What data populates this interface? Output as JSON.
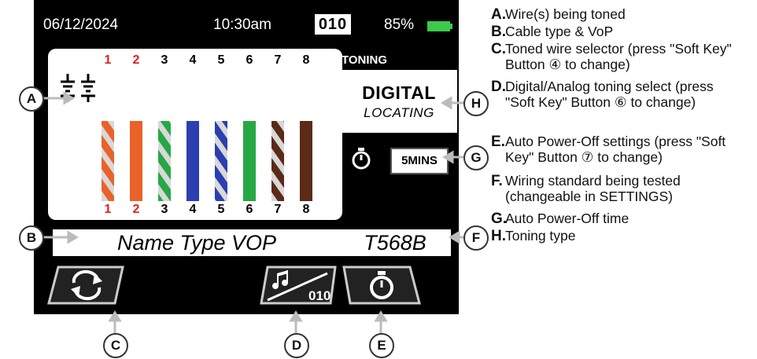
{
  "device": {
    "status_bar": {
      "date": "06/12/2024",
      "time": "10:30am",
      "mode": "010",
      "battery": "85%"
    },
    "wire_panel": {
      "top_pins": [
        "1",
        "2",
        "3",
        "4",
        "5",
        "6",
        "7",
        "8"
      ],
      "bottom_pins": [
        "1",
        "2",
        "3",
        "4",
        "5",
        "6",
        "7",
        "8"
      ],
      "toned_pins": [
        "1",
        "2"
      ],
      "wire_colors": [
        {
          "stripe": "#e9622a",
          "solid": false
        },
        {
          "stripe": "#e9622a",
          "solid": true
        },
        {
          "stripe": "#27a844",
          "solid": false
        },
        {
          "stripe": "#2c3fb0",
          "solid": true
        },
        {
          "stripe": "#2c3fb0",
          "solid": false
        },
        {
          "stripe": "#27a844",
          "solid": true
        },
        {
          "stripe": "#5a2b17",
          "solid": false
        },
        {
          "stripe": "#5a2b17",
          "solid": true
        }
      ]
    },
    "toning": {
      "header": "TONING",
      "type_line1": "DIGITAL",
      "type_line2": "LOCATING"
    },
    "timer_value": "5MINS",
    "cable_info": "Name Type VOP",
    "wiring_standard": "T568B",
    "softkey_center_label": "010"
  },
  "callouts": {
    "a": "A",
    "b": "B",
    "c": "C",
    "d": "D",
    "e": "E",
    "f": "F",
    "g": "G",
    "h": "H"
  },
  "legend": [
    {
      "letter": "A.",
      "text": "Wire(s) being toned"
    },
    {
      "letter": "B.",
      "text": "Cable type & VoP"
    },
    {
      "letter": "C.",
      "text": "Toned wire selector (press \"Soft Key\" Button ④ to change)"
    },
    {
      "letter": "D.",
      "text": "Digital/Analog toning select (press \"Soft Key\" Button ⑥ to change)"
    },
    {
      "letter": "E.",
      "text": "Auto Power-Off settings (press \"Soft Key\" Button ⑦ to change)"
    },
    {
      "letter": "F.",
      "text": "Wiring standard being tested (changeable in SETTINGS)"
    },
    {
      "letter": "G.",
      "text": "Auto Power-Off time"
    },
    {
      "letter": "H.",
      "text": "Toning type"
    }
  ],
  "colors": {
    "screen": "#000000",
    "battery": "#3dca4a",
    "red_pin": "#e02020"
  },
  "icons": [
    "stopwatch-icon",
    "refresh-arrows-icon",
    "music-notes-icon",
    "ground-symbol-icon"
  ]
}
